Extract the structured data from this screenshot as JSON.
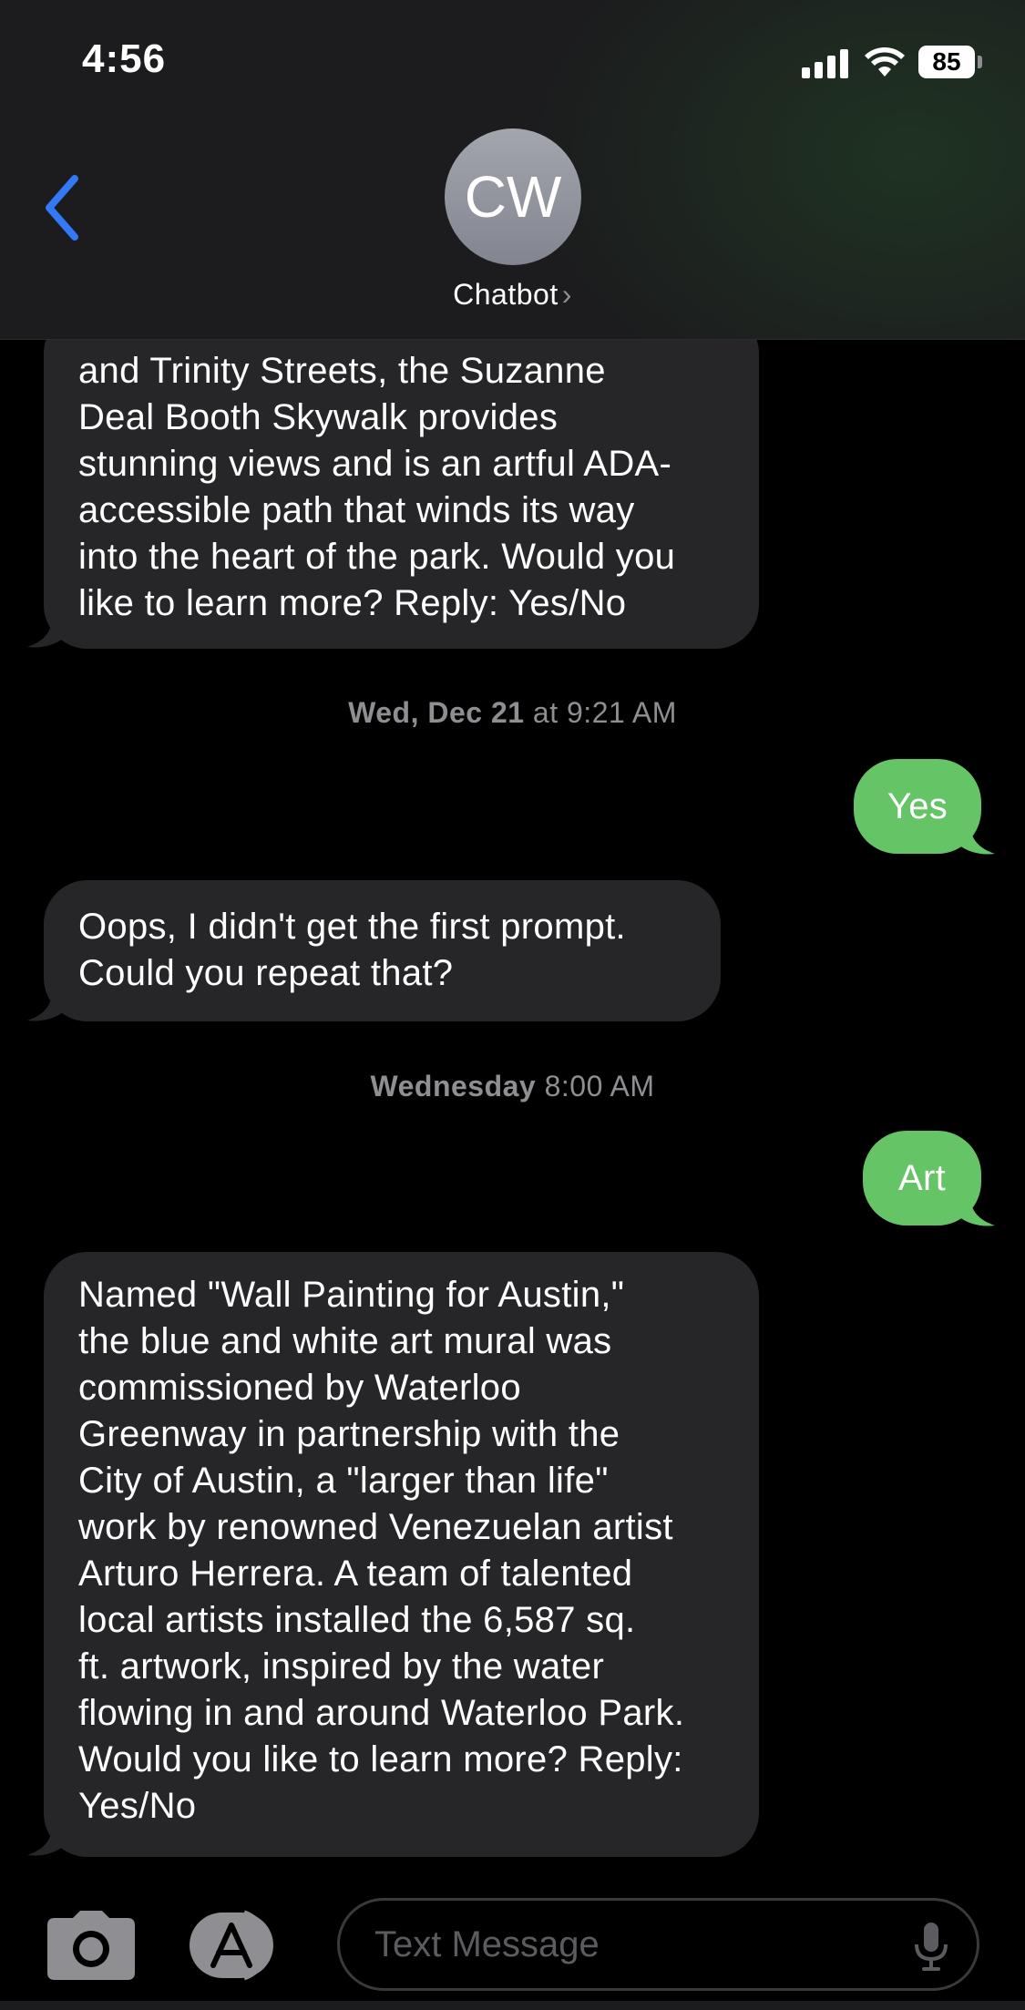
{
  "status_bar": {
    "time": "4:56",
    "battery": "85"
  },
  "header": {
    "avatar_initials": "CW",
    "contact_name": "Chatbot",
    "chevron": "›"
  },
  "messages": [
    {
      "type": "incoming",
      "lines": [
        "and Trinity Streets, the Suzanne",
        "Deal Booth Skywalk provides",
        "stunning views and is an artful ADA-",
        "accessible path that winds its way",
        "into the heart of the park. Would you",
        "like to learn more? Reply: Yes/No"
      ]
    },
    {
      "type": "timestamp",
      "day": "Wed, Dec 21",
      "time": "at 9:21 AM"
    },
    {
      "type": "outgoing",
      "text": "Yes"
    },
    {
      "type": "incoming",
      "lines": [
        "Oops, I didn't get the first prompt.",
        "Could you repeat that?"
      ]
    },
    {
      "type": "timestamp",
      "day": "Wednesday",
      "time": "8:00 AM"
    },
    {
      "type": "outgoing",
      "text": "Art"
    },
    {
      "type": "incoming",
      "lines": [
        "Named \"Wall Painting for Austin,\"",
        "the blue and white art mural was",
        "commissioned by Waterloo",
        "Greenway in partnership with the",
        "City of Austin, a \"larger than life\"",
        "work by renowned Venezuelan artist",
        "Arturo Herrera. A team of talented",
        "local artists installed the 6,587 sq.",
        "ft. artwork, inspired by the water",
        "flowing in and around Waterloo Park.",
        "Would you like to learn more? Reply:",
        "Yes/No"
      ]
    }
  ],
  "composer": {
    "placeholder": "Text Message"
  },
  "icons": {
    "back": "chevron-left-icon",
    "camera": "camera-icon",
    "apps": "app-store-icon",
    "mic": "microphone-icon"
  },
  "colors": {
    "accent": "#3478f6",
    "outgoing_bubble": "#65c466",
    "incoming_bubble": "#262628"
  }
}
